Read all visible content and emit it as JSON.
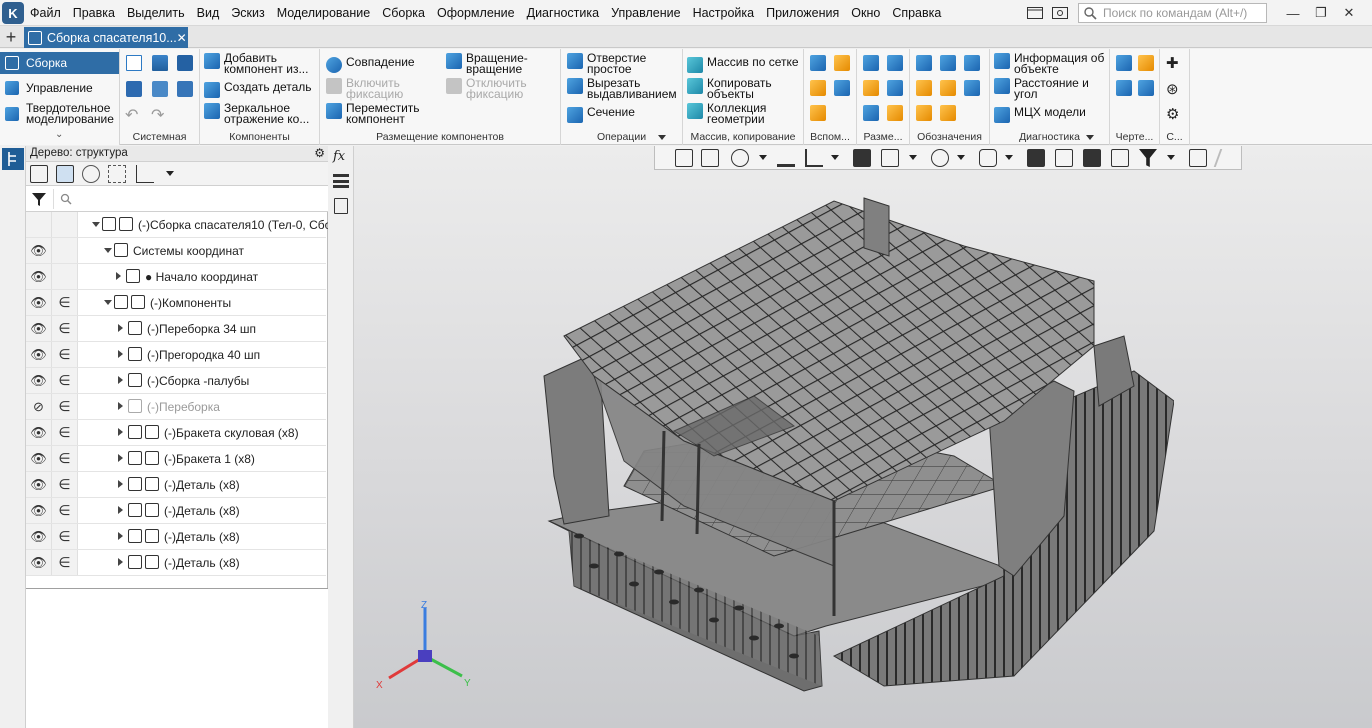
{
  "menu": {
    "items": [
      "Файл",
      "Правка",
      "Выделить",
      "Вид",
      "Эскиз",
      "Моделирование",
      "Сборка",
      "Оформление",
      "Диагностика",
      "Управление",
      "Настройка",
      "Приложения",
      "Окно",
      "Справка"
    ],
    "search_placeholder": "Поиск по командам (Alt+/)"
  },
  "tab": {
    "title": "Сборка спасателя10...",
    "close": "✕",
    "add": "+"
  },
  "ribbon": {
    "modes": [
      "Сборка",
      "Управление",
      "Твердотельное моделирование"
    ],
    "groups": {
      "system": "Системная",
      "components": "Компоненты",
      "placement": "Размещение компонентов",
      "operations": "Операции",
      "arrays": "Массив, копирование",
      "aux": "Вспом...",
      "dims": "Разме...",
      "notation": "Обозначения",
      "diagnostics": "Диагностика",
      "drawing": "Черте...",
      "s": "С..."
    },
    "buttons": {
      "add_component": "Добавить компонент из...",
      "create_part": "Создать деталь",
      "mirror": "Зеркальное отражение ко...",
      "coincidence": "Совпадение",
      "enable_fix": "Включить фиксацию",
      "move_component": "Переместить компонент",
      "rotate": "Вращение-вращение",
      "disable_fix": "Отключить фиксацию",
      "hole": "Отверстие простое",
      "cut_extrude": "Вырезать выдавливанием",
      "section": "Сечение",
      "grid_array": "Массив по сетке",
      "copy_objects": "Копировать объекты",
      "geometry_collection": "Коллекция геометрии",
      "object_info": "Информация об объекте",
      "distance_angle": "Расстояние и угол",
      "mass_props": "МЦХ модели"
    }
  },
  "tree": {
    "title": "Дерево: структура",
    "rows": [
      {
        "label": "(-)Сборка спасателя10 (Тел-0, Сбо",
        "eye": "",
        "fix": "",
        "hidden": false
      },
      {
        "label": "Системы координат",
        "eye": "👁",
        "fix": "",
        "hidden": false
      },
      {
        "label": "● Начало координат",
        "eye": "👁",
        "fix": "",
        "hidden": false
      },
      {
        "label": "(-)Компоненты",
        "eye": "👁",
        "fix": "∈",
        "hidden": false
      },
      {
        "label": "(-)Переборка 34 шп",
        "eye": "👁",
        "fix": "∈",
        "hidden": false
      },
      {
        "label": "(-)Прегородка 40 шп",
        "eye": "👁",
        "fix": "∈",
        "hidden": false
      },
      {
        "label": "(-)Сборка -палубы",
        "eye": "👁",
        "fix": "∈",
        "hidden": false
      },
      {
        "label": "(-)Переборка",
        "eye": "⊘",
        "fix": "∈",
        "hidden": true
      },
      {
        "label": "(-)Бракета скуловая (x8)",
        "eye": "👁",
        "fix": "∈",
        "hidden": false
      },
      {
        "label": "(-)Бракета 1 (x8)",
        "eye": "👁",
        "fix": "∈",
        "hidden": false
      },
      {
        "label": "(-)Деталь (x8)",
        "eye": "👁",
        "fix": "∈",
        "hidden": false
      },
      {
        "label": "(-)Деталь (x8)",
        "eye": "👁",
        "fix": "∈",
        "hidden": false
      },
      {
        "label": "(-)Деталь (x8)",
        "eye": "👁",
        "fix": "∈",
        "hidden": false
      },
      {
        "label": "(-)Деталь (x8)",
        "eye": "👁",
        "fix": "∈",
        "hidden": false
      }
    ]
  },
  "vstrip": {
    "fx": "fx"
  },
  "triad": {
    "x": "X",
    "y": "Y",
    "z": "Z"
  },
  "colors": {
    "accent": "#2f6da6",
    "model": "#6b6b6b"
  }
}
